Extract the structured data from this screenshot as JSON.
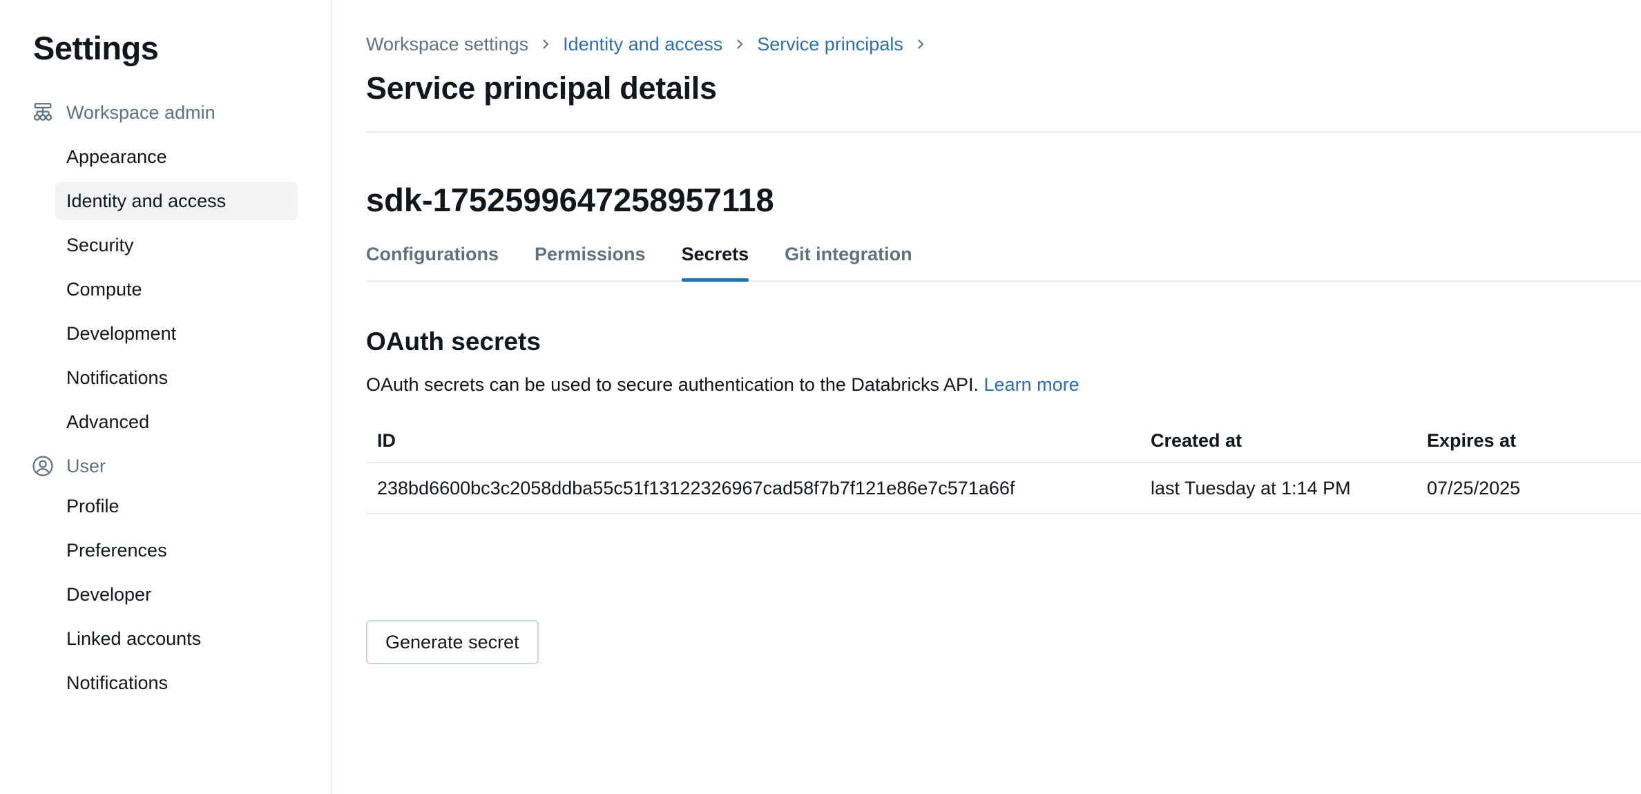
{
  "sidebar": {
    "title": "Settings",
    "workspace_admin": {
      "label": "Workspace admin",
      "icon": "workspace-admin-icon",
      "items": [
        {
          "label": "Appearance"
        },
        {
          "label": "Identity and access",
          "active": true
        },
        {
          "label": "Security"
        },
        {
          "label": "Compute"
        },
        {
          "label": "Development"
        },
        {
          "label": "Notifications"
        },
        {
          "label": "Advanced"
        }
      ]
    },
    "user": {
      "label": "User",
      "icon": "user-circle-icon",
      "items": [
        {
          "label": "Profile"
        },
        {
          "label": "Preferences"
        },
        {
          "label": "Developer"
        },
        {
          "label": "Linked accounts"
        },
        {
          "label": "Notifications"
        }
      ]
    }
  },
  "breadcrumb": {
    "items": [
      "Workspace settings",
      "Identity and access",
      "Service principals"
    ]
  },
  "page_title": "Service principal details",
  "service_principal_name": "sdk-1752599647258957118",
  "tabs": [
    "Configurations",
    "Permissions",
    "Secrets",
    "Git integration"
  ],
  "active_tab": "Secrets",
  "secrets": {
    "title": "OAuth secrets",
    "description": "OAuth secrets can be used to secure authentication to the Databricks API.",
    "learn_more": "Learn more",
    "columns": [
      "ID",
      "Created at",
      "Expires at"
    ],
    "rows": [
      {
        "id": "238bd6600bc3c2058ddba55c51f13122326967cad58f7b7f121e86e7c571a66f",
        "created_at": "last Tuesday at 1:14 PM",
        "expires_at": "07/25/2025"
      }
    ],
    "generate_button": "Generate secret"
  },
  "colors": {
    "link": "#2f6eae",
    "tab_underline": "#2272b4",
    "muted_text": "#5f7281",
    "active_nav_bg": "#f1f3f5"
  }
}
